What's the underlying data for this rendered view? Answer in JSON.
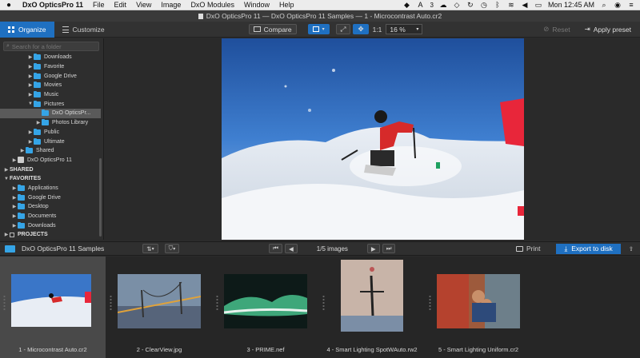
{
  "menubar": {
    "apple": "",
    "app_name": "DxO OpticsPro 11",
    "menus": [
      "File",
      "Edit",
      "View",
      "Image",
      "DxO Modules",
      "Window",
      "Help"
    ],
    "status_badge": "3",
    "clock": "Mon 12:45 AM"
  },
  "window": {
    "title": "DxO OpticsPro 11 — DxO OpticsPro 11 Samples — 1 - Microcontrast Auto.cr2"
  },
  "toolbar": {
    "tab_organize": "Organize",
    "tab_customize": "Customize",
    "compare_label": "Compare",
    "ratio_label": "1:1",
    "zoom_value": "16 %",
    "reset_label": "Reset",
    "apply_preset_label": "Apply preset"
  },
  "sidebar": {
    "search_placeholder": "Search for a folder",
    "tree": [
      {
        "label": "Downloads",
        "indent": 3,
        "arrow": "▶",
        "icon": "folder"
      },
      {
        "label": "Favorite",
        "indent": 3,
        "arrow": "▶",
        "icon": "folder"
      },
      {
        "label": "Google Drive",
        "indent": 3,
        "arrow": "▶",
        "icon": "folder"
      },
      {
        "label": "Movies",
        "indent": 3,
        "arrow": "▶",
        "icon": "folder"
      },
      {
        "label": "Music",
        "indent": 3,
        "arrow": "▶",
        "icon": "folder"
      },
      {
        "label": "Pictures",
        "indent": 3,
        "arrow": "▼",
        "icon": "folder"
      },
      {
        "label": "DxO OpticsPr...",
        "indent": 4,
        "arrow": "",
        "icon": "folder",
        "selected": true
      },
      {
        "label": "Photos Library",
        "indent": 4,
        "arrow": "▶",
        "icon": "folder"
      },
      {
        "label": "Public",
        "indent": 3,
        "arrow": "▶",
        "icon": "folder"
      },
      {
        "label": "Ultimate",
        "indent": 3,
        "arrow": "▶",
        "icon": "folder"
      },
      {
        "label": "Shared",
        "indent": 2,
        "arrow": "▶",
        "icon": "folder"
      },
      {
        "label": "DxO OpticsPro 11",
        "indent": 1,
        "arrow": "▶",
        "icon": "disk"
      },
      {
        "label": "SHARED",
        "indent": 0,
        "arrow": "▶",
        "icon": "none",
        "section": true
      },
      {
        "label": "FAVORITES",
        "indent": 0,
        "arrow": "▼",
        "icon": "none",
        "section": true
      },
      {
        "label": "Applications",
        "indent": 1,
        "arrow": "▶",
        "icon": "folder"
      },
      {
        "label": "Google Drive",
        "indent": 1,
        "arrow": "▶",
        "icon": "folder"
      },
      {
        "label": "Desktop",
        "indent": 1,
        "arrow": "▶",
        "icon": "folder"
      },
      {
        "label": "Documents",
        "indent": 1,
        "arrow": "▶",
        "icon": "folder"
      },
      {
        "label": "Downloads",
        "indent": 1,
        "arrow": "▶",
        "icon": "folder"
      },
      {
        "label": "PROJECTS",
        "indent": 0,
        "arrow": "▶",
        "icon": "grid",
        "section": true
      }
    ]
  },
  "filmbar": {
    "folder_name": "DxO OpticsPro 11 Samples",
    "image_count": "1/5 images",
    "print_label": "Print",
    "export_label": "Export to disk"
  },
  "filmstrip": [
    {
      "caption": "1 - Microcontrast Auto.cr2",
      "kind": "ski",
      "selected": true
    },
    {
      "caption": "2 - ClearView.jpg",
      "kind": "bridge"
    },
    {
      "caption": "3 - PRIME.nef",
      "kind": "wave"
    },
    {
      "caption": "4 - Smart Lighting SpotWAuto.rw2",
      "kind": "acro"
    },
    {
      "caption": "5 - Smart Lighting Uniform.cr2",
      "kind": "kids"
    }
  ],
  "colors": {
    "accent": "#1f70c1",
    "folder": "#35a4e6"
  }
}
